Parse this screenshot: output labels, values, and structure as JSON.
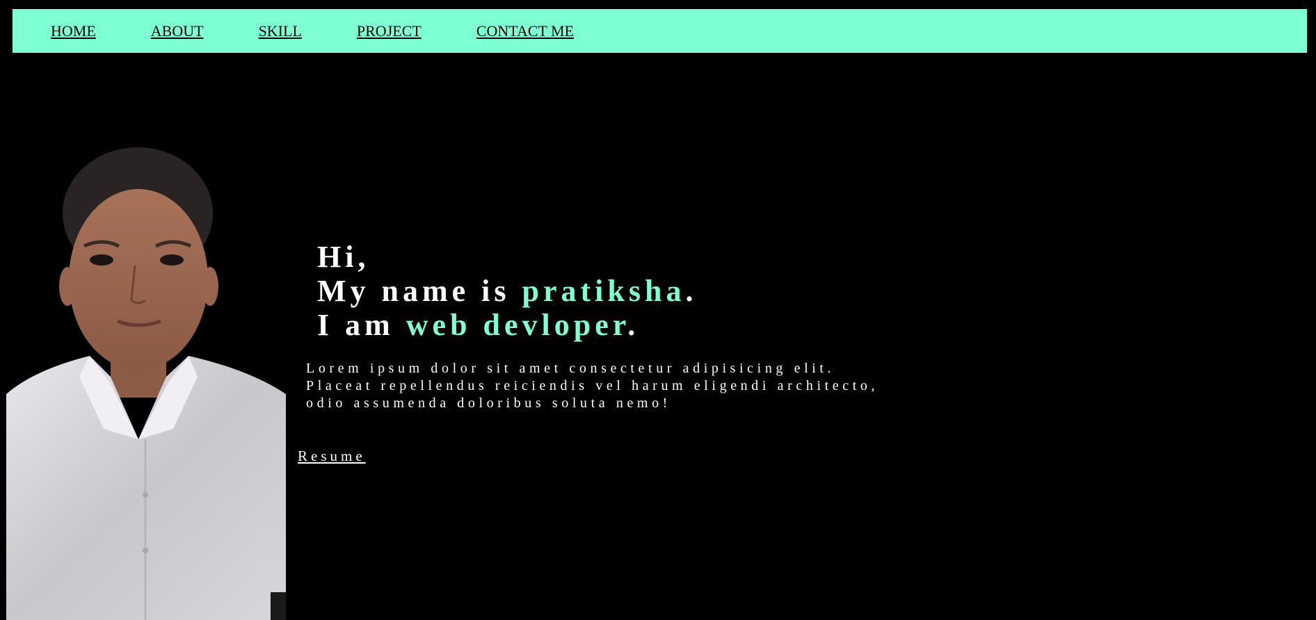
{
  "nav": {
    "items": [
      {
        "label": "HOME"
      },
      {
        "label": "ABOUT"
      },
      {
        "label": "SKILL"
      },
      {
        "label": "PROJECT"
      },
      {
        "label": "CONTACT ME"
      }
    ],
    "background": "#7fffd4"
  },
  "hero": {
    "greeting": "Hi,",
    "name_prefix": "My name is ",
    "name": "pratiksha",
    "name_suffix": ".",
    "role_prefix": "I am ",
    "role": "web devloper",
    "role_suffix": "."
  },
  "description": {
    "line1": "Lorem ipsum dolor sit amet consectetur adipisicing elit.",
    "line2": "Placeat repellendus reiciendis vel harum eligendi architecto,",
    "line3": "odio assumenda doloribus soluta nemo!"
  },
  "resume_link": "Resume",
  "colors": {
    "accent": "#7fffd4",
    "background": "#000000",
    "text": "#ffffff"
  }
}
